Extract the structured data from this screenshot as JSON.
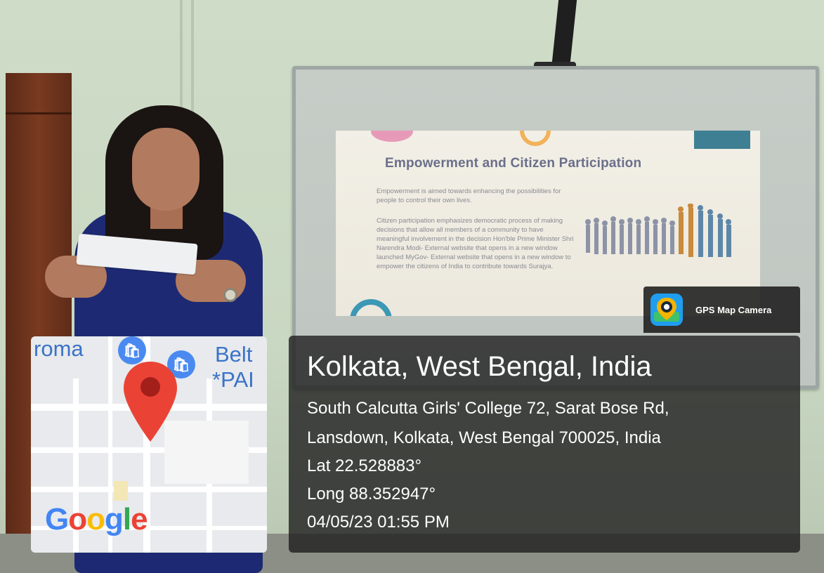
{
  "slide": {
    "title": "Empowerment and Citizen Participation",
    "paragraph1": "Empowerment is aimed towards enhancing the possibilities for people to control their own lives.",
    "paragraph2": "Citizen participation emphasizes democratic process of making decisions that allow all members of a community to have meaningful involvement in the decision Hon'ble Prime Minister Shri Narendra Modi- External website that opens in a new window launched MyGov- External website that opens in a new window to empower the citizens of India to contribute towards Surajya."
  },
  "map": {
    "label_left": "roma",
    "label_right_1": "Belt",
    "label_right_2": "*PAI",
    "logo": [
      "G",
      "o",
      "o",
      "g",
      "l",
      "e"
    ]
  },
  "badge": {
    "app_name": "GPS Map Camera",
    "icon": "gps-map-camera-icon"
  },
  "location": {
    "title": "Kolkata, West Bengal, India",
    "address_line1": "South Calcutta Girls' College 72, Sarat Bose Rd,",
    "address_line2": "Lansdown, Kolkata, West Bengal 700025, India",
    "latitude": "Lat 22.528883°",
    "longitude": "Long 88.352947°",
    "timestamp": "04/05/23 01:55 PM"
  },
  "colors": {
    "map_pin": "#ea4335",
    "map_bag": "#4a8af0",
    "overlay": "#1e1e1e"
  }
}
